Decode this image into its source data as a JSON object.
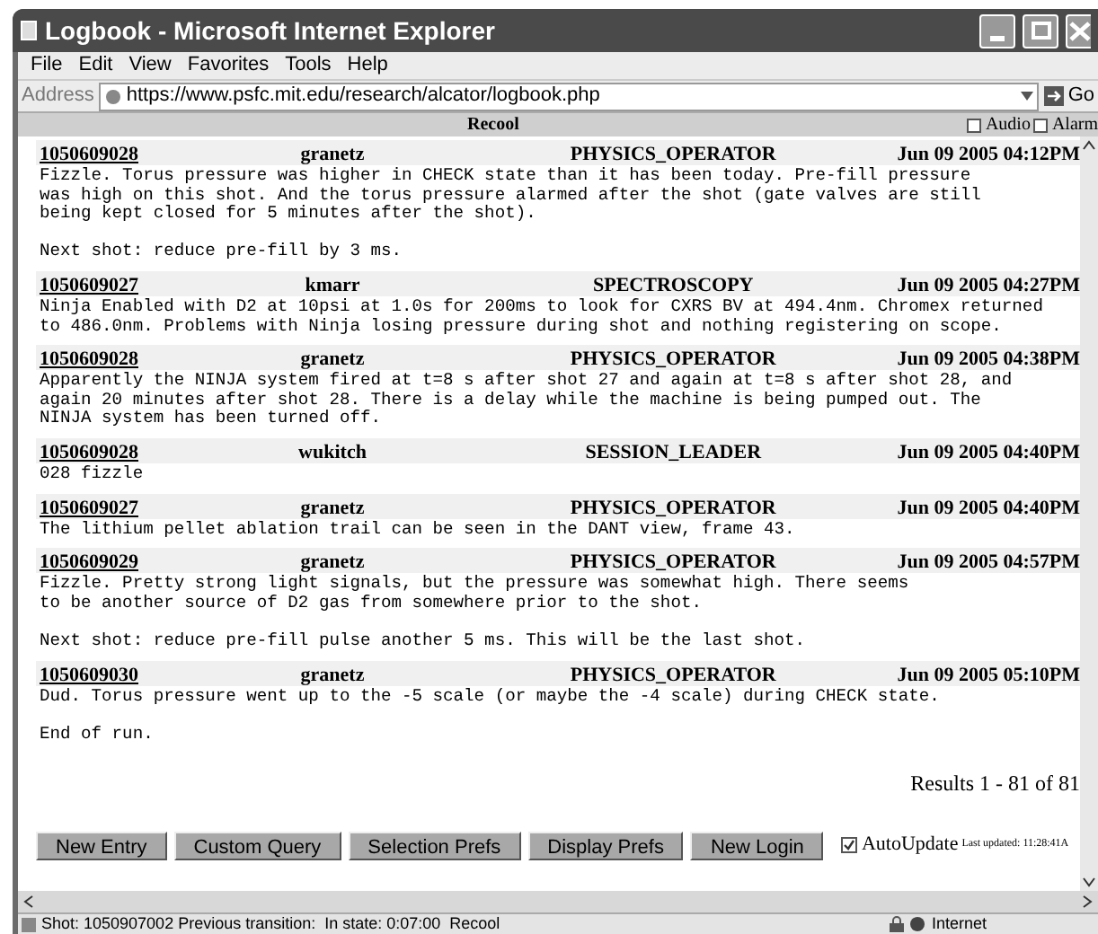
{
  "window": {
    "title": "Logbook - Microsoft Internet Explorer"
  },
  "menu": [
    "File",
    "Edit",
    "View",
    "Favorites",
    "Tools",
    "Help"
  ],
  "address": {
    "label": "Address",
    "value": "https://www.psfc.mit.edu/research/alcator/logbook.php",
    "go": "Go"
  },
  "banner": {
    "title": "Recool",
    "options": [
      {
        "label": "Audio",
        "checked": false
      },
      {
        "label": "Alarm",
        "checked": false
      }
    ]
  },
  "entries": [
    {
      "shot": "1050609028",
      "user": "granetz",
      "role": "PHYSICS_OPERATOR",
      "time": "Jun 09 2005 04:12PM",
      "paragraphs": [
        [
          "Fizzle. Torus pressure was higher in CHECK state than it has been today. Pre-fill pressure",
          "was high on this shot. And the torus pressure alarmed after the shot (gate valves are still",
          "being kept closed for 5 minutes after the shot)."
        ],
        [
          "Next shot: reduce pre-fill by 3 ms."
        ]
      ]
    },
    {
      "shot": "1050609027",
      "user": "kmarr",
      "role": "SPECTROSCOPY",
      "time": "Jun 09 2005 04:27PM",
      "paragraphs": [
        [
          "Ninja Enabled with D2 at 10psi at 1.0s for 200ms to look for CXRS BV at 494.4nm. Chromex returned",
          "to 486.0nm. Problems with Ninja losing pressure during shot and nothing registering on scope."
        ]
      ]
    },
    {
      "shot": "1050609028",
      "user": "granetz",
      "role": "PHYSICS_OPERATOR",
      "time": "Jun 09 2005 04:38PM",
      "paragraphs": [
        [
          "Apparently the NINJA system fired at t=8 s after shot 27 and again at t=8 s after shot 28, and",
          "again 20 minutes after shot 28. There is a delay while the machine is being pumped out. The",
          "NINJA system has been turned off."
        ]
      ]
    },
    {
      "shot": "1050609028",
      "user": "wukitch",
      "role": "SESSION_LEADER",
      "time": "Jun 09 2005 04:40PM",
      "paragraphs": [
        [
          "028 fizzle"
        ]
      ]
    },
    {
      "shot": "1050609027",
      "user": "granetz",
      "role": "PHYSICS_OPERATOR",
      "time": "Jun 09 2005 04:40PM",
      "paragraphs": [
        [
          "The lithium pellet ablation trail can be seen in the DANT view, frame 43."
        ]
      ]
    },
    {
      "shot": "1050609029",
      "user": "granetz",
      "role": "PHYSICS_OPERATOR",
      "time": "Jun 09 2005 04:57PM",
      "paragraphs": [
        [
          "Fizzle. Pretty strong light signals, but the pressure was somewhat high. There seems",
          "to be another source of D2 gas from somewhere prior to the shot."
        ],
        [
          "Next shot: reduce pre-fill pulse another 5 ms. This will be the last shot."
        ]
      ]
    },
    {
      "shot": "1050609030",
      "user": "granetz",
      "role": "PHYSICS_OPERATOR",
      "time": "Jun 09 2005 05:10PM",
      "paragraphs": [
        [
          "Dud. Torus pressure went up to the -5 scale (or maybe the -4 scale) during CHECK state."
        ],
        [
          "End of run."
        ]
      ]
    }
  ],
  "results": "Results 1 - 81 of 81",
  "buttons": [
    "New Entry",
    "Custom Query",
    "Selection Prefs",
    "Display Prefs",
    "New Login"
  ],
  "autoupdate": {
    "label": "AutoUpdate",
    "checked": true,
    "last_updated": "Last updated: 11:28:41A"
  },
  "status_bar": {
    "text": "Shot: 1050907002 Previous transition:  In state: 0:07:00  Recool",
    "zone": "Internet"
  }
}
